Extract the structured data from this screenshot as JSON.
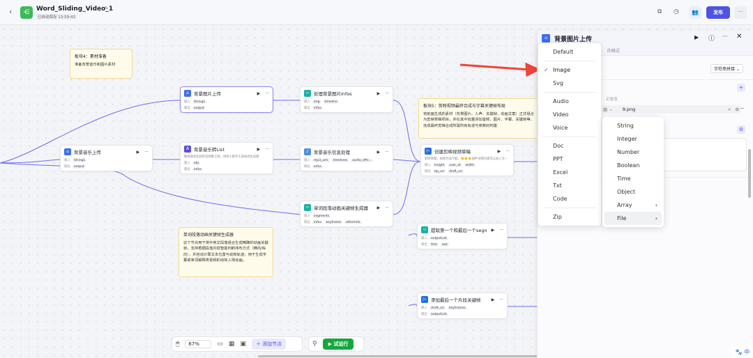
{
  "header": {
    "title": "Word_Sliding_Video_1",
    "autosave": "已自动保存 13:59:43",
    "publish": "发布",
    "more": "···"
  },
  "canvas": {
    "notes": [
      {
        "title": "板块4：素材准备",
        "body": "准备背景音乐和图片素材"
      },
      {
        "title": "板块5：剪映视频最终合成与字幕关键帧布局",
        "body": "将前面生成的素材（背景图片、人声、关键帧、动画文案）正式组合为剪映草稿项目，并在其中批量添加音频、图片、字幕、关键帧等，完成最终剪辑合成所需所有轨道与参数的构建"
      },
      {
        "title": "单词段落动画关键帧生成器",
        "body": "这个节点用于将中英文段落组合生成精确的动画关键帧，支持根据段落内容智能判断排布方式（横向/纵向），并自动计算文本位置与动效轨迹，用于生成字幕或单词解释类视频的动效入场动画。"
      }
    ],
    "labels": {
      "in": "输入",
      "out": "输出"
    },
    "nodes": [
      {
        "title": "背景图片上传",
        "inputs": [
          "String1"
        ],
        "outputs": [
          "output"
        ]
      },
      {
        "title": "背景音乐上传",
        "inputs": [
          "String1"
        ],
        "outputs": [
          "output"
        ]
      },
      {
        "title": "背景音乐转List",
        "desc": "数组格式化获得音频数工具，请到小助手工具格式生成题",
        "inputs": [
          "obj"
        ],
        "outputs": [
          "infos"
        ]
      },
      {
        "title": "处理背景图片Infos",
        "inputs": [
          "img",
          "timeline"
        ],
        "outputs": [
          "infos"
        ]
      },
      {
        "title": "背景音乐信息处理",
        "inputs": [
          "mp3_urls",
          "timelines",
          "audio_effe..."
        ],
        "outputs": [
          "infos"
        ]
      },
      {
        "title": "创建剪映视频草稿",
        "desc": "剪映草稿，视频合成万能。👏👏👏插件详情页面可以加入交···",
        "inputs": [
          "height",
          "user_id",
          "width"
        ],
        "outputs": [
          "tip_url",
          "draft_url"
        ]
      },
      {
        "title": "单词段落动画关键帧生成器",
        "inputs": [
          "segments"
        ],
        "outputs": [
          "infos",
          "keyframe",
          "otherInfo"
        ]
      },
      {
        "title": "提取第一个和最后一个segment···",
        "inputs": [
          "outputList"
        ],
        "outputs": [
          "first",
          "last"
        ]
      },
      {
        "title": "添加最后一个片段关键帧",
        "inputs": [
          "draft_url",
          "keyframes"
        ],
        "outputs": [
          "outputList"
        ]
      }
    ]
  },
  "toolbar": {
    "zoom": "67%",
    "add_node": "添加节点",
    "test_run": "试运行"
  },
  "panel": {
    "title": "背景图片上传",
    "subtitle_fragment": "的格式",
    "mode": "字符串拼接",
    "field_fragment": "定量值",
    "file_value": "9.png"
  },
  "type_menu": {
    "items": [
      "Default",
      "Image",
      "Svg",
      "Audio",
      "Video",
      "Voice",
      "Doc",
      "PPT",
      "Excel",
      "Txt",
      "Code",
      "Zip"
    ],
    "selected": "Image"
  },
  "type_submenu": {
    "items": [
      "String",
      "Integer",
      "Number",
      "Boolean",
      "Time",
      "Object",
      "Array",
      "File"
    ],
    "hovered": "File"
  },
  "ime": {
    "label": "中"
  },
  "colors": {
    "accent": "#4d53e8",
    "run": "#14a83b",
    "edge": "#6b6bf5",
    "arrow": "#f04438"
  }
}
